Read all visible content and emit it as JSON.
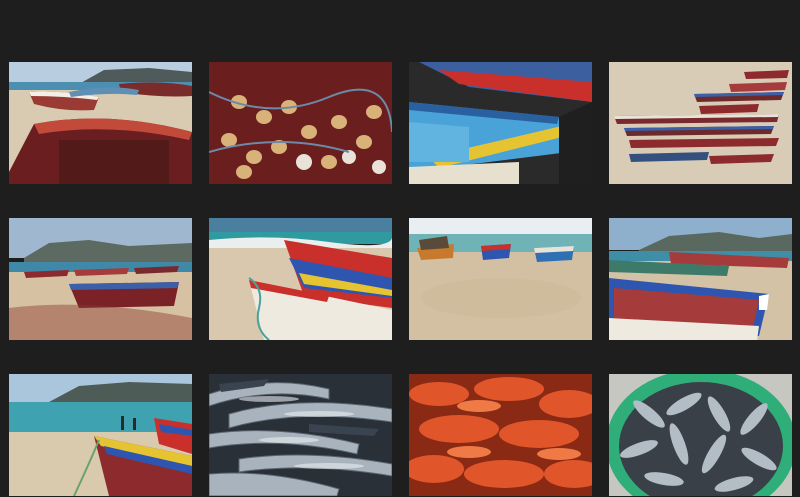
{
  "gallery": {
    "thumbnails": [
      {
        "subject": "boats-on-beach-with-nets",
        "accent": "#b0453a"
      },
      {
        "subject": "fishing-nets-and-floats",
        "accent": "#7a1f1f"
      },
      {
        "subject": "colorful-boat-hulls-closeup",
        "accent": "#4aa3d8"
      },
      {
        "subject": "rows-of-boats-on-sand",
        "accent": "#8c2a2e"
      },
      {
        "subject": "boats-on-beach-with-mountain",
        "accent": "#3b5fa8"
      },
      {
        "subject": "boat-prows-by-sea",
        "accent": "#c9302c"
      },
      {
        "subject": "three-boats-on-shore",
        "accent": "#2f6fb3"
      },
      {
        "subject": "blue-boat-with-mountain",
        "accent": "#2e56b0"
      },
      {
        "subject": "beach-people-and-boat",
        "accent": "#2aa6b0"
      },
      {
        "subject": "silver-fish-pile",
        "accent": "#8e9aa6"
      },
      {
        "subject": "red-fish-pile",
        "accent": "#e0552a"
      },
      {
        "subject": "fish-in-green-basin",
        "accent": "#2fae7a"
      }
    ]
  }
}
